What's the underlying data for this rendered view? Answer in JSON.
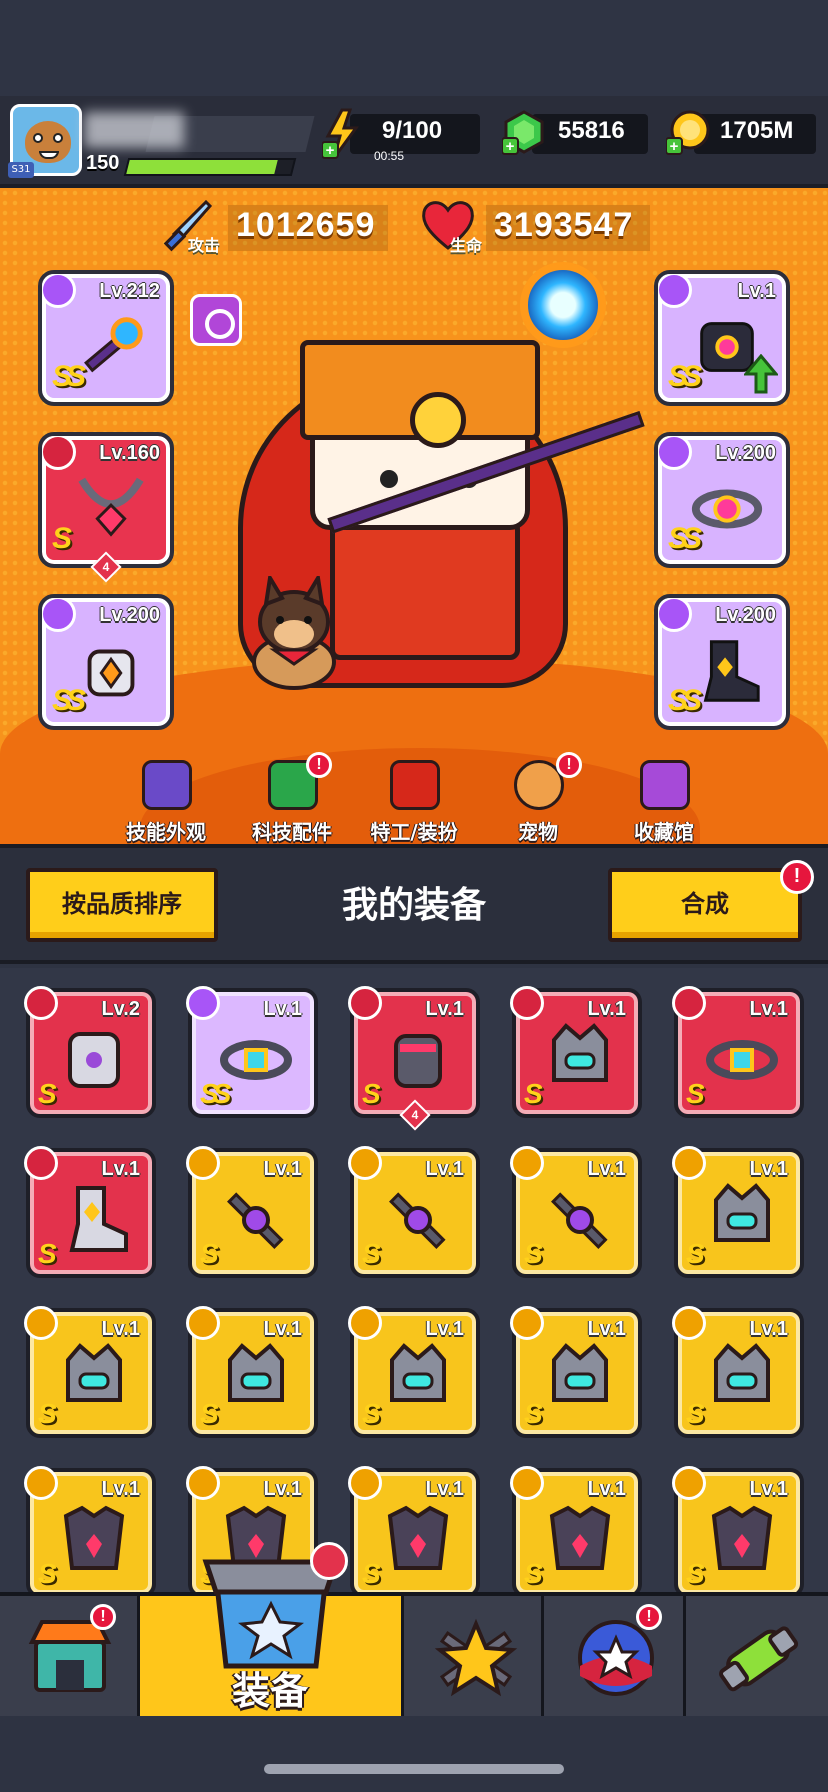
{
  "player": {
    "level": "150",
    "avatar_tag": "S31",
    "xp_fraction": 0.9
  },
  "resources": {
    "energy": "9/100",
    "energy_timer": "00:55",
    "gems": "55816",
    "coins": "1705M"
  },
  "stats": {
    "attack_label": "攻击",
    "attack_value": "1012659",
    "hp_label": "生命",
    "hp_value": "3193547"
  },
  "equipped": {
    "left": [
      {
        "level": "Lv.212",
        "grade": "SS",
        "rarity": "purple",
        "icon": "staff-icon"
      },
      {
        "level": "Lv.160",
        "grade": "S",
        "rarity": "red",
        "icon": "necklace-icon",
        "stars": "4"
      },
      {
        "level": "Lv.200",
        "grade": "SS",
        "rarity": "purple",
        "icon": "glove-icon"
      }
    ],
    "right": [
      {
        "level": "Lv.1",
        "grade": "SS",
        "rarity": "purple",
        "icon": "armor-icon",
        "upgrade": true
      },
      {
        "level": "Lv.200",
        "grade": "SS",
        "rarity": "purple",
        "icon": "belt-icon"
      },
      {
        "level": "Lv.200",
        "grade": "SS",
        "rarity": "purple",
        "icon": "boots-icon"
      }
    ]
  },
  "shortcuts": [
    {
      "label": "技能外观",
      "badge": false
    },
    {
      "label": "科技配件",
      "badge": true
    },
    {
      "label": "特工/装扮",
      "badge": false
    },
    {
      "label": "宠物",
      "badge": true
    },
    {
      "label": "收藏馆",
      "badge": false
    }
  ],
  "inventory": {
    "sort_button": "按品质排序",
    "title": "我的装备",
    "merge_button": "合成",
    "merge_badge": "!",
    "rows": [
      [
        {
          "level": "Lv.2",
          "grade": "S",
          "rarity": "red",
          "icon": "armor-icon"
        },
        {
          "level": "Lv.1",
          "grade": "SS",
          "rarity": "purple",
          "icon": "belt-icon"
        },
        {
          "level": "Lv.1",
          "grade": "S",
          "rarity": "red",
          "icon": "glove-icon",
          "stars": "4"
        },
        {
          "level": "Lv.1",
          "grade": "S",
          "rarity": "red",
          "icon": "helmet-icon"
        },
        {
          "level": "Lv.1",
          "grade": "S",
          "rarity": "red",
          "icon": "belt-icon"
        }
      ],
      [
        {
          "level": "Lv.1",
          "grade": "S",
          "rarity": "red",
          "icon": "boots-icon"
        },
        {
          "level": "Lv.1",
          "grade": "S",
          "rarity": "yellow",
          "icon": "weapon-icon"
        },
        {
          "level": "Lv.1",
          "grade": "S",
          "rarity": "yellow",
          "icon": "weapon-icon"
        },
        {
          "level": "Lv.1",
          "grade": "S",
          "rarity": "yellow",
          "icon": "weapon-icon"
        },
        {
          "level": "Lv.1",
          "grade": "S",
          "rarity": "yellow",
          "icon": "helmet-icon"
        }
      ],
      [
        {
          "level": "Lv.1",
          "grade": "S",
          "rarity": "yellow",
          "icon": "helmet-icon"
        },
        {
          "level": "Lv.1",
          "grade": "S",
          "rarity": "yellow",
          "icon": "helmet-icon"
        },
        {
          "level": "Lv.1",
          "grade": "S",
          "rarity": "yellow",
          "icon": "helmet-icon"
        },
        {
          "level": "Lv.1",
          "grade": "S",
          "rarity": "yellow",
          "icon": "helmet-icon"
        },
        {
          "level": "Lv.1",
          "grade": "S",
          "rarity": "yellow",
          "icon": "helmet-icon"
        }
      ],
      [
        {
          "level": "Lv.1",
          "grade": "S",
          "rarity": "yellow",
          "icon": "chest-armor-icon"
        },
        {
          "level": "Lv.1",
          "grade": "S",
          "rarity": "yellow",
          "icon": "chest-armor-icon"
        },
        {
          "level": "Lv.1",
          "grade": "S",
          "rarity": "yellow",
          "icon": "chest-armor-icon"
        },
        {
          "level": "Lv.1",
          "grade": "S",
          "rarity": "yellow",
          "icon": "chest-armor-icon"
        },
        {
          "level": "Lv.1",
          "grade": "S",
          "rarity": "yellow",
          "icon": "chest-armor-icon"
        }
      ]
    ]
  },
  "nav": {
    "active_label": "装备",
    "items": [
      {
        "name": "shop",
        "badge": true
      },
      {
        "name": "equipment",
        "badge": false
      },
      {
        "name": "battle",
        "badge": false
      },
      {
        "name": "challenge",
        "badge": true
      },
      {
        "name": "lab",
        "badge": false
      }
    ]
  },
  "colors": {
    "hero_bg": "#f7931c",
    "rarity_red": "#e3324c",
    "rarity_purple": "#dcb8ff",
    "rarity_yellow": "#f8c51c",
    "button_yellow": "#ffce1a",
    "badge_red": "#e6163d"
  }
}
